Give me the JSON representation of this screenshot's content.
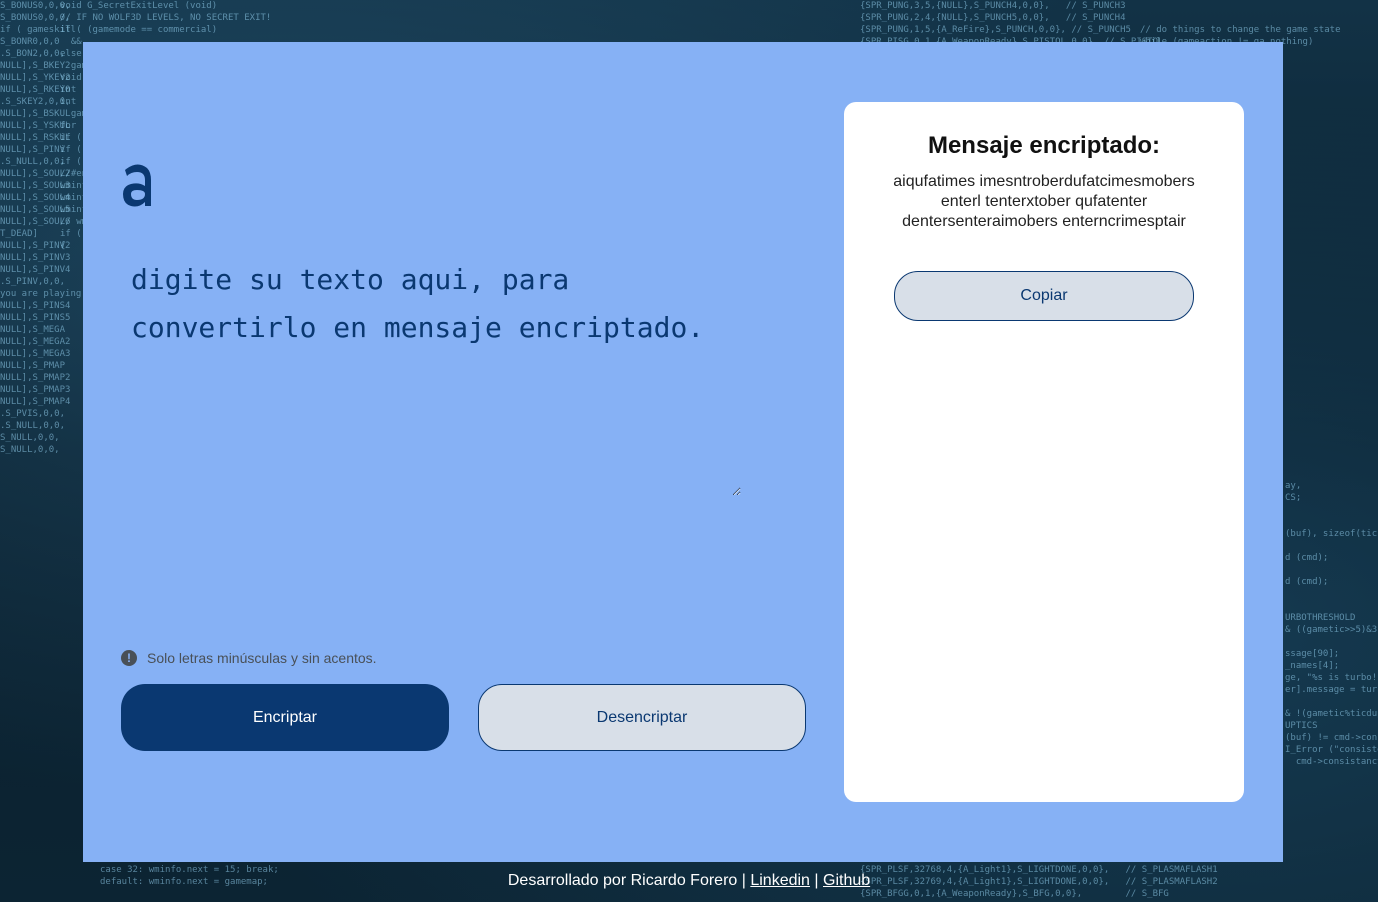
{
  "colors": {
    "panel_bg": "#86b1f5",
    "primary": "#0a3871",
    "secondary_btn_bg": "#d8dfe8",
    "card_bg": "#ffffff",
    "hint_text": "#495057"
  },
  "logo": {
    "icon": "alura-a-logo"
  },
  "input": {
    "placeholder": "digite su texto aqui, para convertirlo en mensaje encriptado.",
    "value": ""
  },
  "hint": {
    "icon": "exclamation-circle-icon",
    "text": "Solo letras minúsculas y sin acentos."
  },
  "buttons": {
    "encrypt_label": "Encriptar",
    "decrypt_label": "Desencriptar"
  },
  "output": {
    "title": "Mensaje encriptado:",
    "text": "aiqufatimes imesntroberdufatcimesmobers enterl tenterxtober qufatenter dentersenteraimobers enterncrimesptair",
    "copy_label": "Copiar"
  },
  "footer": {
    "prefix": "Desarrollado por Ricardo Forero | ",
    "linkedin_label": "Linkedin",
    "separator": " | ",
    "github_label": "Github"
  }
}
